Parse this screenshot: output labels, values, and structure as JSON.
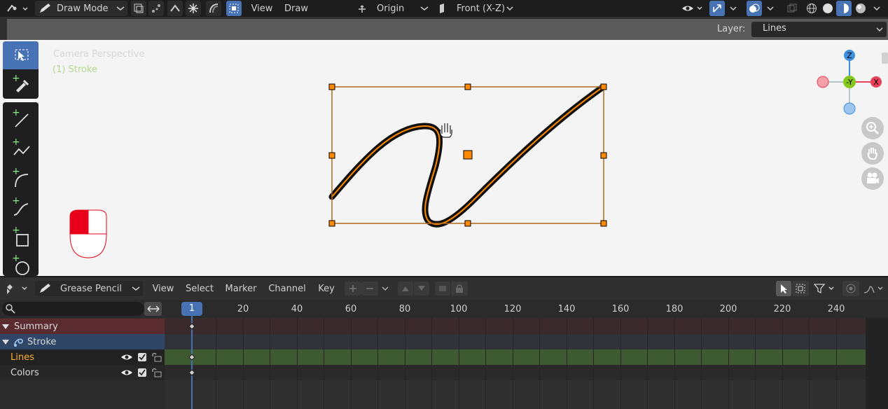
{
  "header": {
    "mode": "Draw Mode",
    "menus": [
      "View",
      "Draw"
    ],
    "origin": "Origin",
    "orientation": "Front (X-Z)"
  },
  "layer_bar": {
    "label": "Layer:",
    "value": "Lines"
  },
  "viewport": {
    "camera_text": "Camera Perspective",
    "object_text": "(1) Stroke",
    "gizmo": {
      "z": "Z",
      "y": "-Y",
      "x": "X"
    }
  },
  "timeline": {
    "editor": "Grease Pencil",
    "menus": [
      "View",
      "Select",
      "Marker",
      "Channel",
      "Key"
    ],
    "current_frame": "1",
    "frame_ticks": [
      "20",
      "40",
      "60",
      "80",
      "100",
      "120",
      "140",
      "160",
      "180",
      "200",
      "220",
      "240"
    ],
    "channels": {
      "summary": "Summary",
      "object": "Stroke",
      "layer1": "Lines",
      "layer2": "Colors"
    }
  },
  "colors": {
    "accent": "#4772b3",
    "select": "#ff8a00",
    "layer_active": "#ffaf29"
  }
}
